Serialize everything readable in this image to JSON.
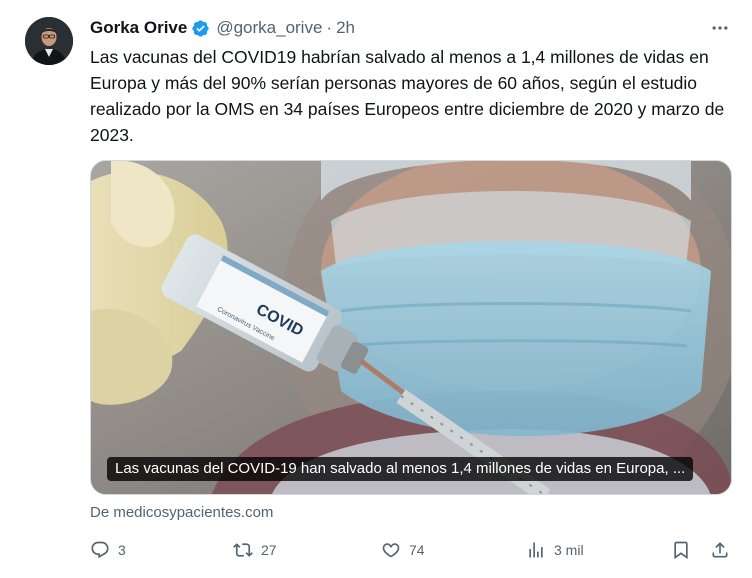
{
  "author": {
    "name": "Gorka Orive",
    "handle": "@gorka_orive",
    "separator": "·",
    "time": "2h",
    "verified_color": "#1d9bf0"
  },
  "tweet": {
    "text": "Las vacunas del COVID19 habrían salvado al menos a 1,4 millones de vidas en Europa y más del 90% serían personas mayores de 60 años, según el estudio realizado por la OMS en 34 países Europeos entre diciembre de 2020 y marzo de 2023."
  },
  "card": {
    "caption": "Las vacunas del COVID-19 han salvado al menos 1,4 millones de vidas en Europa, ...",
    "source": "De medicosypacientes.com",
    "vial_label": "COVID",
    "vial_sublabel": "Coronavirus Vaccine"
  },
  "actions": {
    "replies": "3",
    "reposts": "27",
    "likes": "74",
    "views": "3 mil"
  },
  "icons": {
    "more": "more-dots-icon",
    "reply": "reply-bubble-icon",
    "repost": "repost-icon",
    "like": "heart-icon",
    "views": "views-chart-icon",
    "bookmark": "bookmark-icon",
    "share": "share-icon"
  }
}
